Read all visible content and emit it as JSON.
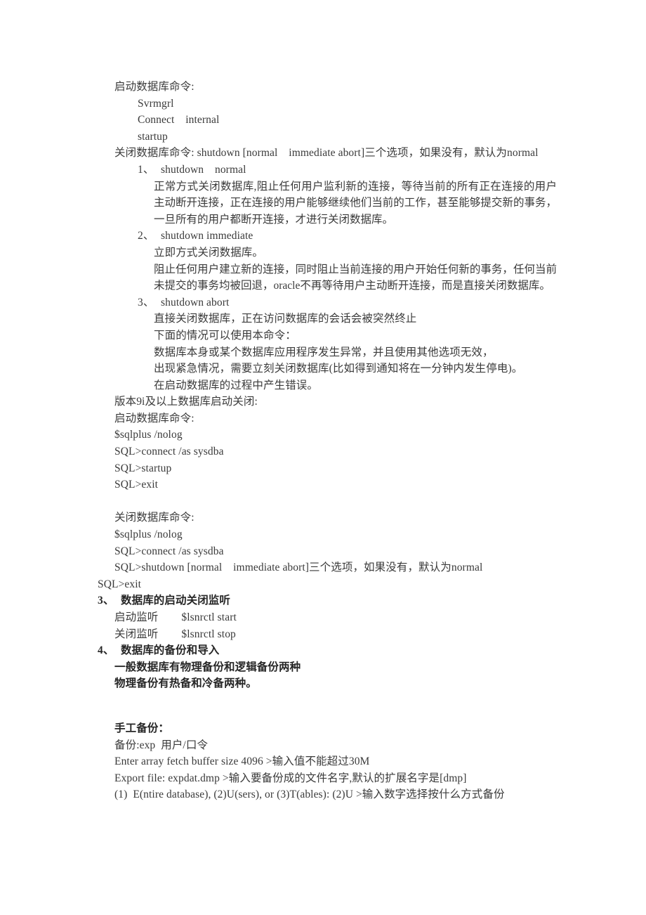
{
  "document": {
    "startup_heading": "启动数据库命令:",
    "startup_cmds": [
      "Svrmgrl",
      "Connect    internal",
      "startup"
    ],
    "shutdown_heading": "关闭数据库命令: shutdown [normal    immediate abort]三个选项，如果没有，默认为normal",
    "shutdown_options": [
      {
        "number": "1、",
        "title": "shutdown    normal",
        "body": "正常方式关闭数据库,阻止任何用户监利新的连接，等待当前的所有正在连接的用户主动断开连接，正在连接的用户能够继续他们当前的工作，甚至能够提交新的事务，一旦所有的用户都断开连接，才进行关闭数据库。"
      },
      {
        "number": "2、",
        "title": "shutdown immediate",
        "body_lines": [
          "立即方式关闭数据库。"
        ],
        "body": "阻止任何用户建立新的连接，同时阻止当前连接的用户开始任何新的事务，任何当前未提交的事务均被回退，oracle不再等待用户主动断开连接，而是直接关闭数据库。"
      },
      {
        "number": "3、",
        "title": "shutdown abort",
        "body_lines": [
          "直接关闭数据库，正在访问数据库的会话会被突然终止",
          "下面的情况可以使用本命令：",
          "数据库本身或某个数据库应用程序发生异常，并且使用其他选项无效，",
          "出现紧急情况，需要立刻关闭数据库(比如得到通知将在一分钟内发生停电)。",
          "在启动数据库的过程中产生错误。"
        ]
      }
    ],
    "version_heading": "版本9i及以上数据库启动关闭:",
    "v9_startup_heading": "启动数据库命令:",
    "v9_startup_cmds": [
      "$sqlplus /nolog",
      "SQL>connect /as sysdba",
      "SQL>startup",
      "SQL>exit"
    ],
    "v9_shutdown_heading": "关闭数据库命令:",
    "v9_shutdown_cmds": [
      "$sqlplus /nolog",
      "SQL>connect /as sysdba",
      "SQL>shutdown [normal    immediate abort]三个选项，如果没有，默认为normal"
    ],
    "v9_shutdown_exit": "SQL>exit",
    "section3": {
      "number": "3、",
      "title": "数据库的启动关闭监听",
      "rows": [
        {
          "label": "启动监听",
          "cmd": "$lsnrctl start"
        },
        {
          "label": "关闭监听",
          "cmd": "$lsnrctl stop"
        }
      ]
    },
    "section4": {
      "number": "4、",
      "title": "数据库的备份和导入",
      "lines": [
        "一般数据库有物理备份和逻辑备份两种",
        "物理备份有热备和冷备两种。"
      ]
    },
    "manual_backup": {
      "heading": "手工备份：",
      "lines": [
        "备份:exp  用户/口令",
        "Enter array fetch buffer size 4096 >输入值不能超过30M",
        "Export file: expdat.dmp >输入要备份成的文件名字,默认的扩展名字是[dmp]",
        "(1)  E(ntire database), (2)U(sers), or (3)T(ables): (2)U >输入数字选择按什么方式备份"
      ]
    }
  }
}
